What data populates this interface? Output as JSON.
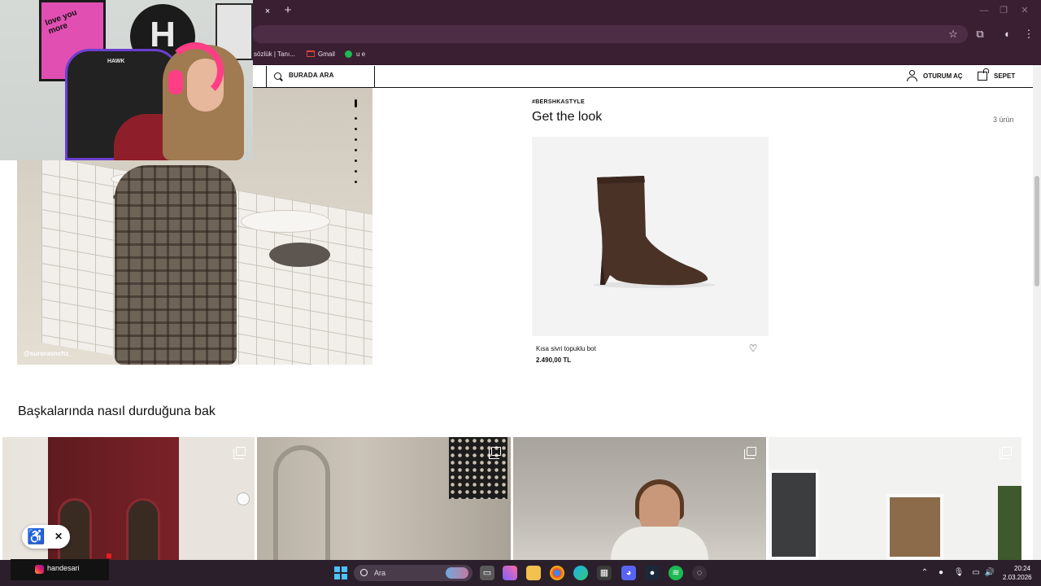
{
  "browser": {
    "bookmarks": [
      {
        "label": "sözlük | Tanı..."
      },
      {
        "label": "Gmail"
      },
      {
        "label": "u e"
      }
    ],
    "controls": {
      "close_tab": "×",
      "new_tab": "+",
      "minimize": "—",
      "restore": "❐",
      "close_window": "✕"
    },
    "toolbar_icons": [
      "star-icon",
      "extensions-icon",
      "profile-icon",
      "menu-icon"
    ]
  },
  "header": {
    "search_label": "BURADA ARA",
    "login_label": "OTURUM AÇ",
    "cart_label": "SEPET"
  },
  "look": {
    "photo_credit": "@surorasnchz_",
    "carousel": {
      "total": 9,
      "active": 1
    },
    "hashtag": "#BERSHKASTYLE",
    "title": "Get the look",
    "item_count": "3 ürün",
    "product": {
      "name": "Kısa sivri topuklu bot",
      "price": "2.490,00 TL"
    }
  },
  "others": {
    "title": "Başkalarında nasıl durduğuna bak",
    "tiles": 4
  },
  "accessibility": {
    "icon": "accessibility-icon",
    "close": "✕"
  },
  "webcam": {
    "poster_text": "love you more",
    "chair_brand": "HAWK",
    "logo_letter": "H"
  },
  "instagram": {
    "handle": "handesari"
  },
  "taskbar": {
    "search_label": "Ara",
    "time": "20:24",
    "date": "2.03.2026"
  },
  "colors": {
    "browser_chrome": "#3a1f33",
    "taskbar": "#2b1f2c",
    "text": "#111111",
    "boot": "#4b3226"
  }
}
